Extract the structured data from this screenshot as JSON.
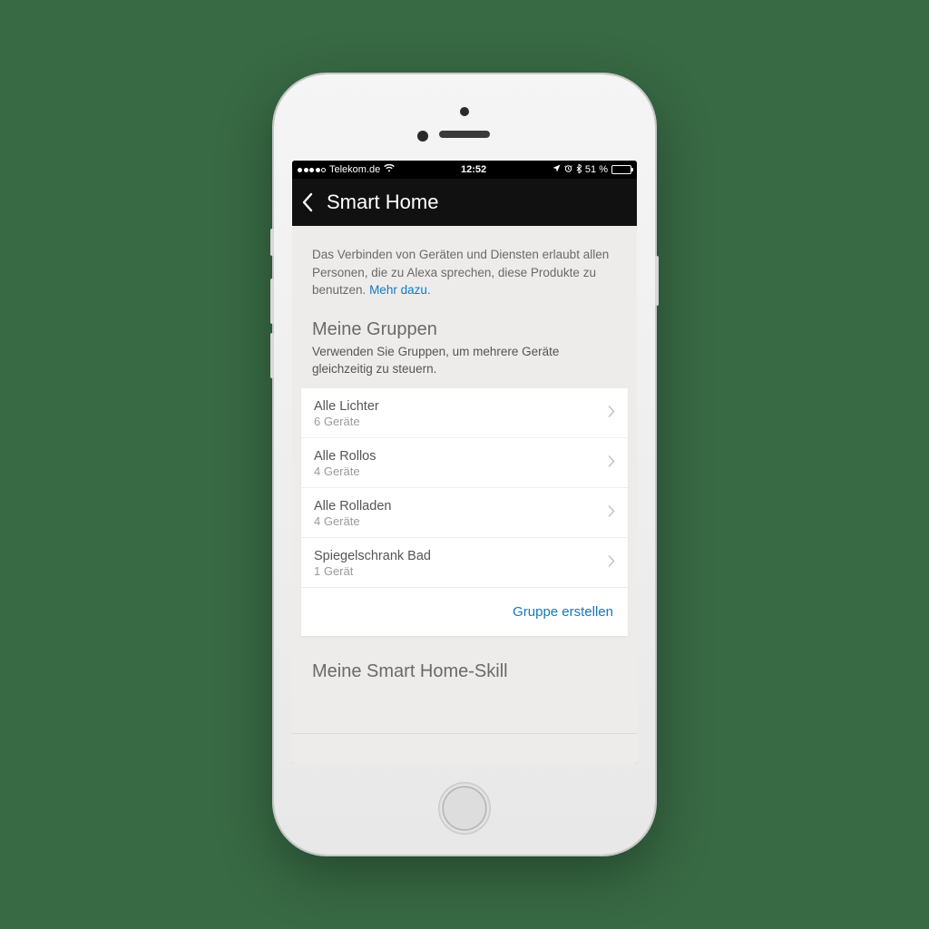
{
  "status": {
    "carrier": "Telekom.de",
    "time": "12:52",
    "battery_pct": "51 %"
  },
  "nav": {
    "title": "Smart Home"
  },
  "intro": {
    "text": "Das Verbinden von Geräten und Diensten erlaubt allen Personen, die zu Alexa sprechen, diese Produkte zu benutzen. ",
    "link": "Mehr dazu."
  },
  "groups": {
    "title": "Meine Gruppen",
    "subtitle": "Verwenden Sie Gruppen, um mehrere Geräte gleichzeitig zu steuern.",
    "items": [
      {
        "name": "Alle Lichter",
        "meta": "6 Geräte"
      },
      {
        "name": "Alle Rollos",
        "meta": "4 Geräte"
      },
      {
        "name": "Alle Rolladen",
        "meta": "4 Geräte"
      },
      {
        "name": "Spiegelschrank Bad",
        "meta": "1 Gerät"
      }
    ],
    "action": "Gruppe erstellen"
  },
  "next_section_peek": "Meine Smart Home-Skill"
}
